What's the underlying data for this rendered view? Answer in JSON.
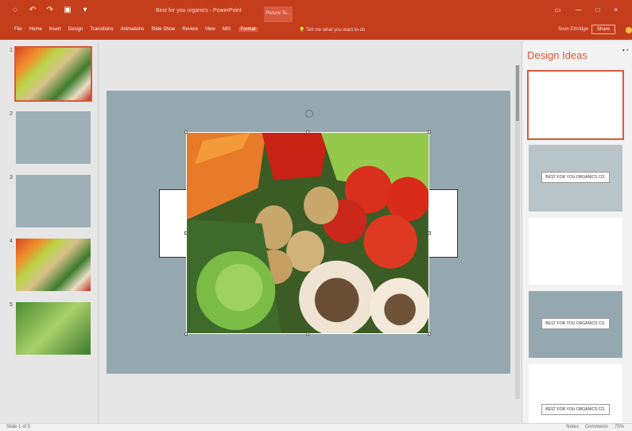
{
  "window": {
    "title": "Best for you organics - PowerPoint",
    "context_tab_title": "Picture To..."
  },
  "ribbon": {
    "tabs": [
      "File",
      "Home",
      "Insert",
      "Design",
      "Transitions",
      "Animations",
      "Slide Show",
      "Review",
      "View",
      "MIX",
      "Format"
    ],
    "active_tab": "Format",
    "tell_me_placeholder": "Tell me what you want to do",
    "user_name": "Sean Ethridge",
    "share_label": "Share"
  },
  "slides": [
    {
      "number": "1"
    },
    {
      "number": "2"
    },
    {
      "number": "3"
    },
    {
      "number": "4"
    },
    {
      "number": "5"
    }
  ],
  "design_ideas": {
    "title": "Design Ideas",
    "cards": [
      {
        "caption": ""
      },
      {
        "caption": "BEST FOR YOU ORGANICS CO."
      },
      {
        "caption": ""
      },
      {
        "caption": "BEST FOR YOU ORGANICS CO."
      },
      {
        "caption": "BEST FOR YOU ORGANICS CO."
      }
    ]
  },
  "status": {
    "slide_info": "Slide 1 of 5",
    "notes_label": "Notes",
    "comments_label": "Comments",
    "zoom": "75%"
  }
}
